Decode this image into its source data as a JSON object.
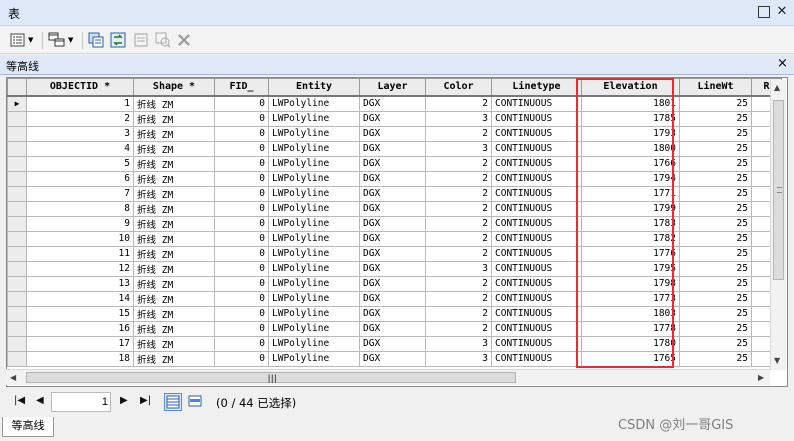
{
  "window": {
    "title": "表"
  },
  "tab": {
    "name": "等高线"
  },
  "table": {
    "columns": [
      "OBJECTID *",
      "Shape *",
      "FID_",
      "Entity",
      "Layer",
      "Color",
      "Linetype",
      "Elevation",
      "LineWt",
      "R"
    ],
    "rows": [
      [
        "1",
        "折线 ZM",
        "0",
        "LWPolyline",
        "DGX",
        "2",
        "CONTINUOUS",
        "1801",
        "25"
      ],
      [
        "2",
        "折线 ZM",
        "0",
        "LWPolyline",
        "DGX",
        "3",
        "CONTINUOUS",
        "1785",
        "25"
      ],
      [
        "3",
        "折线 ZM",
        "0",
        "LWPolyline",
        "DGX",
        "2",
        "CONTINUOUS",
        "1793",
        "25"
      ],
      [
        "4",
        "折线 ZM",
        "0",
        "LWPolyline",
        "DGX",
        "3",
        "CONTINUOUS",
        "1800",
        "25"
      ],
      [
        "5",
        "折线 ZM",
        "0",
        "LWPolyline",
        "DGX",
        "2",
        "CONTINUOUS",
        "1766",
        "25"
      ],
      [
        "6",
        "折线 ZM",
        "0",
        "LWPolyline",
        "DGX",
        "2",
        "CONTINUOUS",
        "1794",
        "25"
      ],
      [
        "7",
        "折线 ZM",
        "0",
        "LWPolyline",
        "DGX",
        "2",
        "CONTINUOUS",
        "1771",
        "25"
      ],
      [
        "8",
        "折线 ZM",
        "0",
        "LWPolyline",
        "DGX",
        "2",
        "CONTINUOUS",
        "1799",
        "25"
      ],
      [
        "9",
        "折线 ZM",
        "0",
        "LWPolyline",
        "DGX",
        "2",
        "CONTINUOUS",
        "1783",
        "25"
      ],
      [
        "10",
        "折线 ZM",
        "0",
        "LWPolyline",
        "DGX",
        "2",
        "CONTINUOUS",
        "1782",
        "25"
      ],
      [
        "11",
        "折线 ZM",
        "0",
        "LWPolyline",
        "DGX",
        "2",
        "CONTINUOUS",
        "1776",
        "25"
      ],
      [
        "12",
        "折线 ZM",
        "0",
        "LWPolyline",
        "DGX",
        "3",
        "CONTINUOUS",
        "1795",
        "25"
      ],
      [
        "13",
        "折线 ZM",
        "0",
        "LWPolyline",
        "DGX",
        "2",
        "CONTINUOUS",
        "1798",
        "25"
      ],
      [
        "14",
        "折线 ZM",
        "0",
        "LWPolyline",
        "DGX",
        "2",
        "CONTINUOUS",
        "1773",
        "25"
      ],
      [
        "15",
        "折线 ZM",
        "0",
        "LWPolyline",
        "DGX",
        "2",
        "CONTINUOUS",
        "1803",
        "25"
      ],
      [
        "16",
        "折线 ZM",
        "0",
        "LWPolyline",
        "DGX",
        "2",
        "CONTINUOUS",
        "1778",
        "25"
      ],
      [
        "17",
        "折线 ZM",
        "0",
        "LWPolyline",
        "DGX",
        "3",
        "CONTINUOUS",
        "1780",
        "25"
      ],
      [
        "18",
        "折线 ZM",
        "0",
        "LWPolyline",
        "DGX",
        "3",
        "CONTINUOUS",
        "1765",
        "25"
      ]
    ]
  },
  "navigator": {
    "current_record": "1",
    "selection_status": "(0 / 44 已选择)"
  },
  "bottom_tab": {
    "name": "等高线"
  },
  "watermark": "CSDN @刘一哥GIS",
  "colors": {
    "highlight": "#e03030",
    "titlebar": "#dfe8f6",
    "header_bg": "#ececec"
  },
  "icons": {
    "table-options": "table-options-icon",
    "related-tables": "related-tables-icon",
    "select-by-attributes": "select-by-attributes-icon",
    "switch-selection": "switch-selection-icon",
    "clear-selection": "clear-selection-icon",
    "zoom-to-selected": "zoom-to-selected-icon",
    "delete-selected": "delete-icon"
  }
}
